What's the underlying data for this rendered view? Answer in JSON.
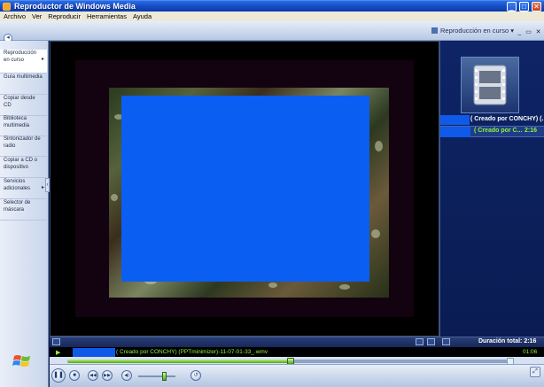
{
  "window": {
    "title": "Reproductor de Windows Media",
    "buttons": {
      "minimize": "_",
      "maximize": "□",
      "close": "✕"
    }
  },
  "menu": [
    "Archivo",
    "Ver",
    "Reproducir",
    "Herramientas",
    "Ayuda"
  ],
  "header": {
    "view_selector": "Reproducción en curso",
    "view_arrow": "▾"
  },
  "taskbar": {
    "items": [
      {
        "label": "Reproducción en curso",
        "active": true,
        "has_arrow": true
      },
      {
        "label": "Guía multimedia",
        "active": false,
        "has_arrow": false
      },
      {
        "label": "Copiar desde CD",
        "active": false,
        "has_arrow": false
      },
      {
        "label": "Biblioteca multimedia",
        "active": false,
        "has_arrow": false
      },
      {
        "label": "Sintonizador de radio",
        "active": false,
        "has_arrow": false
      },
      {
        "label": "Copiar a CD o dispositivo",
        "active": false,
        "has_arrow": false
      },
      {
        "label": "Servicios adicionales",
        "active": false,
        "has_arrow": true
      },
      {
        "label": "Selector de máscara",
        "active": false,
        "has_arrow": false
      }
    ]
  },
  "playlist": {
    "items": [
      {
        "title": "( Creado por CONCHY) (...",
        "duration": "",
        "state": "normal"
      },
      {
        "title": "( Creado por C...",
        "duration": "2:16",
        "state": "playing"
      }
    ],
    "total_label": "Duración total: 2:16"
  },
  "status": {
    "play_glyph": "▶",
    "media_title": "( Creado por CONCHY) (PPTminimizer)-11-07-01-33_.wmv",
    "elapsed": "01:06"
  },
  "playback": {
    "progress_fraction": 0.5,
    "volume_fraction": 0.7
  },
  "controls": {
    "pause": "❚❚",
    "stop": "■",
    "previous": "◀◀",
    "next": "▶▶",
    "mute": "◀)",
    "restore": "↺",
    "fullscreen": "⤢"
  },
  "colors": {
    "accent_blue": "#0f5ae8",
    "playing_green": "#8cf23c",
    "titlebar": "#1650c8"
  }
}
